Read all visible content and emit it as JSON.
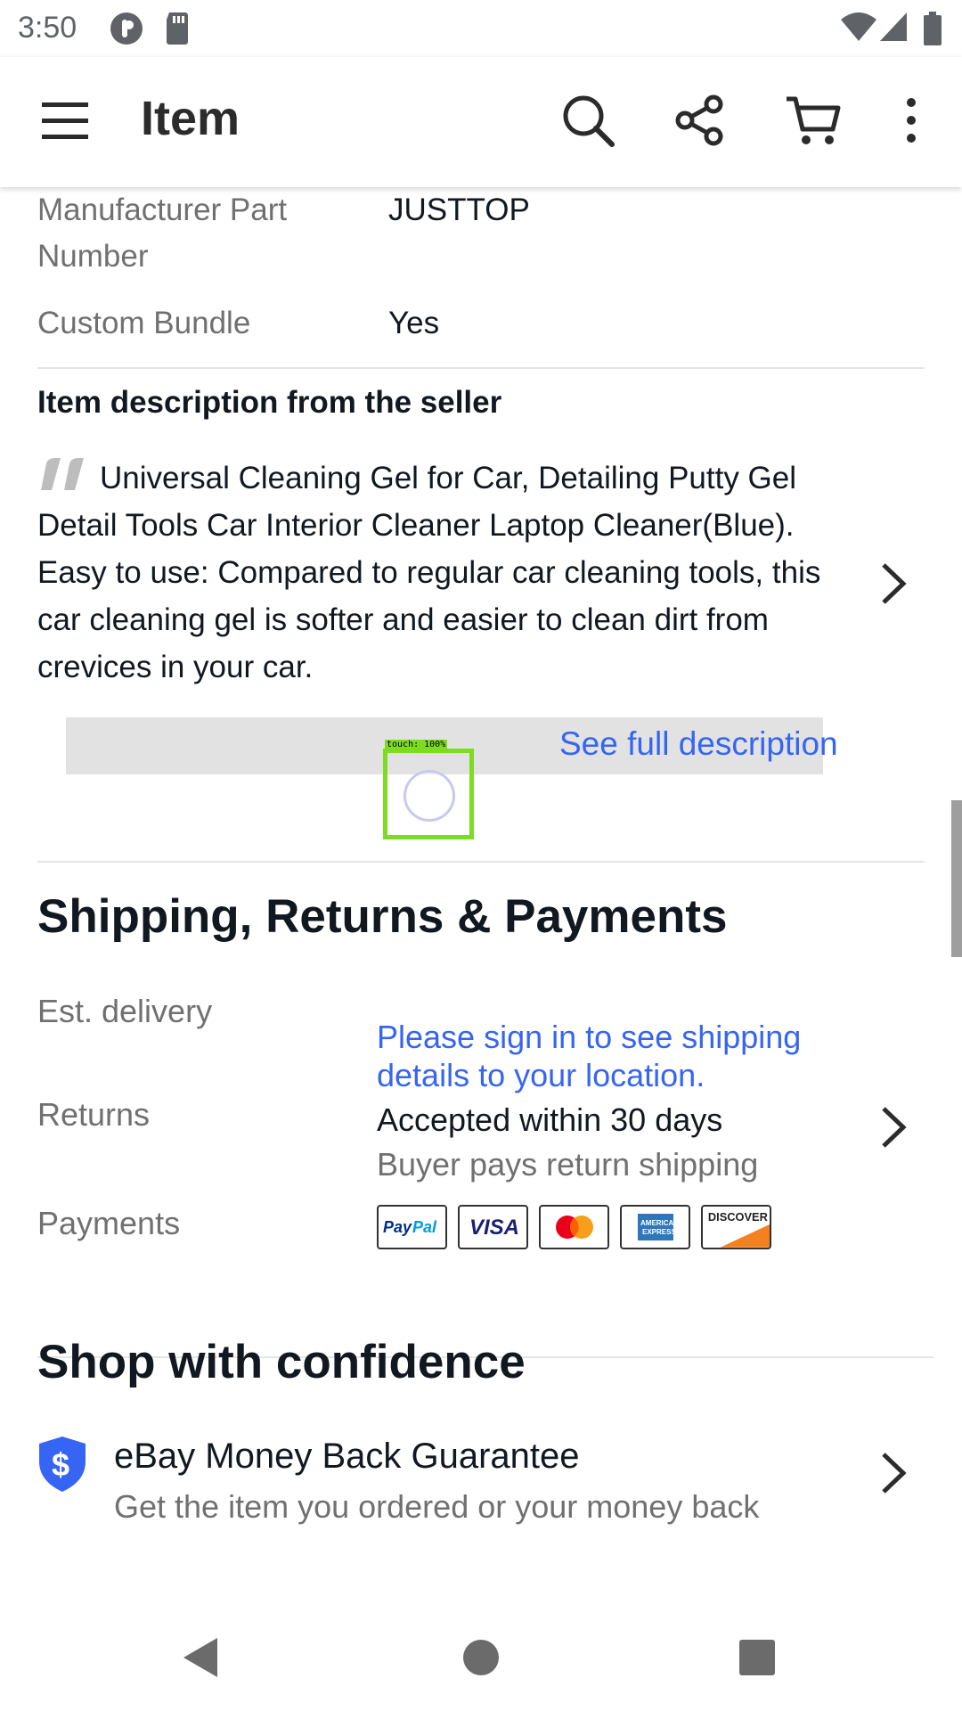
{
  "status_bar": {
    "time": "3:50"
  },
  "app_bar": {
    "title": "Item"
  },
  "specs": [
    {
      "label": "Manufacturer Part Number",
      "value": "JUSTTOP"
    },
    {
      "label": "Custom Bundle",
      "value": "Yes"
    }
  ],
  "description": {
    "heading": "Item description from the seller",
    "text": "Universal Cleaning Gel for Car, Detailing Putty Gel Detail Tools Car Interior Cleaner Laptop Cleaner(Blue). Easy to use: Compared to regular car cleaning tools, this car cleaning gel is softer and easier to clean dirt from crevices in your car.",
    "see_full": "See full description"
  },
  "touch_overlay": {
    "label": "touch: 100%"
  },
  "shipping": {
    "heading": "Shipping, Returns & Payments",
    "delivery_label": "Est. delivery",
    "delivery_value": "Please sign in to see shipping details to your location.",
    "returns_label": "Returns",
    "returns_value": "Accepted within 30 days",
    "returns_sub": "Buyer pays return shipping",
    "payments_label": "Payments",
    "payment_methods": [
      "PayPal",
      "VISA",
      "Mastercard",
      "American Express",
      "Discover"
    ]
  },
  "confidence": {
    "heading": "Shop with confidence",
    "guarantee_title": "eBay Money Back Guarantee",
    "guarantee_sub": "Get the item you ordered or your money back"
  },
  "icons": {
    "menu": "menu-icon",
    "search": "search-icon",
    "share": "share-icon",
    "cart": "cart-icon",
    "more": "more-vert-icon",
    "shield": "shield-dollar-icon",
    "chevron": "chevron-right-icon",
    "back": "nav-back-icon",
    "home": "nav-home-icon",
    "recents": "nav-recents-icon"
  },
  "colors": {
    "link": "#3665f3",
    "text": "#111820",
    "muted": "#707070",
    "touch_box": "#7ddc1f"
  }
}
